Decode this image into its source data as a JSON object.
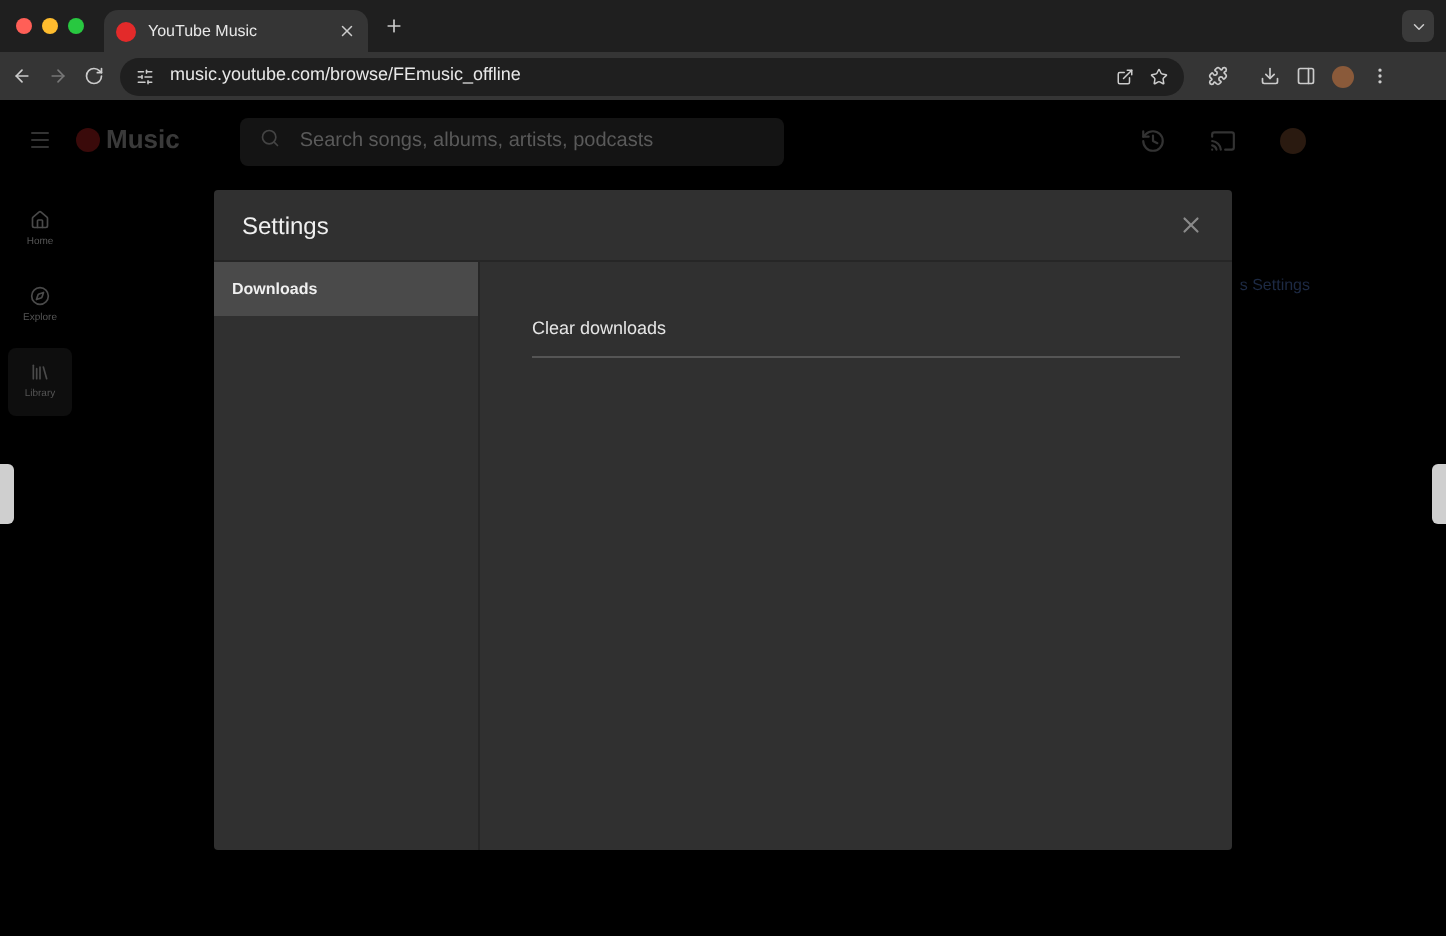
{
  "browser": {
    "tabs": [
      {
        "title": "YouTube Music",
        "selected": true
      }
    ],
    "url": "music.youtube.com/browse/FEmusic_offline"
  },
  "app": {
    "logo": "Music",
    "search": {
      "placeholder": "Search songs, albums, artists, podcasts"
    },
    "nav": [
      {
        "label": "Home",
        "selected": false
      },
      {
        "label": "Explore",
        "selected": false
      },
      {
        "label": "Library",
        "selected": true
      }
    ],
    "background_text": "s Settings"
  },
  "dialog": {
    "title": "Settings",
    "sections": [
      {
        "label": "Downloads",
        "selected": true
      }
    ],
    "items": [
      "Clear downloads"
    ]
  }
}
